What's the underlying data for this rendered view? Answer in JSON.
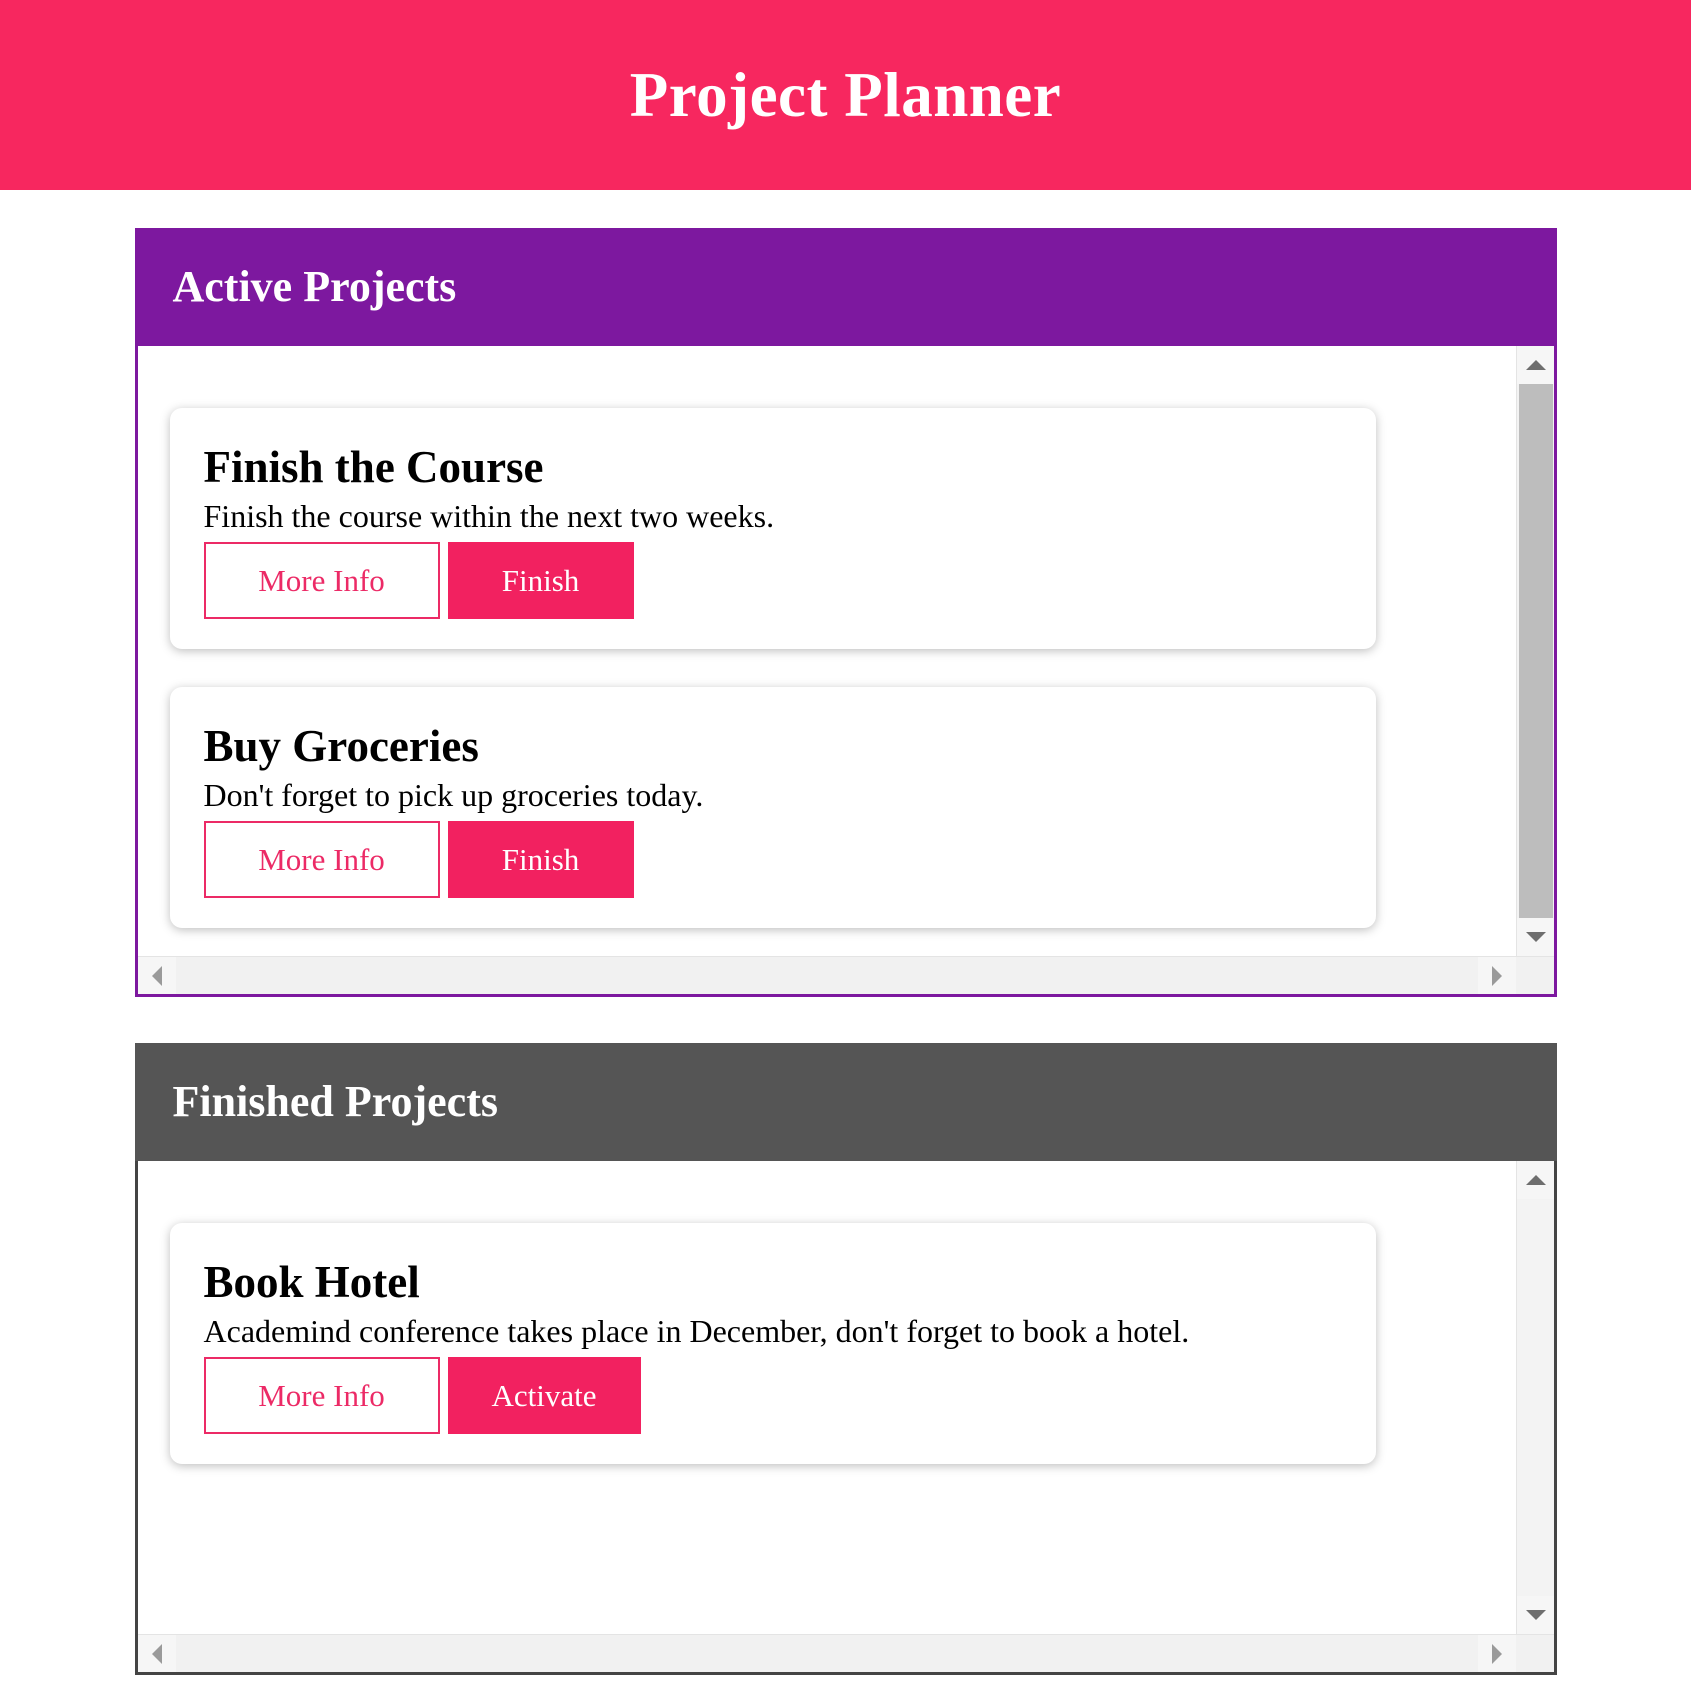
{
  "app": {
    "title": "Project Planner",
    "accent_pink": "#f7275f",
    "accent_purple": "#7d189f",
    "accent_gray": "#555555",
    "button_pink": "#ec2a66"
  },
  "panels": [
    {
      "id": "active-projects",
      "header": "Active Projects",
      "header_color": "#7d189f",
      "projects": [
        {
          "title": "Finish the Course",
          "description": "Finish the course within the next two weeks.",
          "info_button": "More Info",
          "action_button": "Finish"
        },
        {
          "title": "Buy Groceries",
          "description": "Don't forget to pick up groceries today.",
          "info_button": "More Info",
          "action_button": "Finish"
        }
      ]
    },
    {
      "id": "finished-projects",
      "header": "Finished Projects",
      "header_color": "#555555",
      "projects": [
        {
          "title": "Book Hotel",
          "description": "Academind conference takes place in December, don't forget to book a hotel.",
          "info_button": "More Info",
          "action_button": "Activate"
        }
      ]
    }
  ],
  "scrollbars": {
    "up_arrow": "scroll-up-icon",
    "down_arrow": "scroll-down-icon",
    "left_arrow": "scroll-left-icon",
    "right_arrow": "scroll-right-icon"
  }
}
